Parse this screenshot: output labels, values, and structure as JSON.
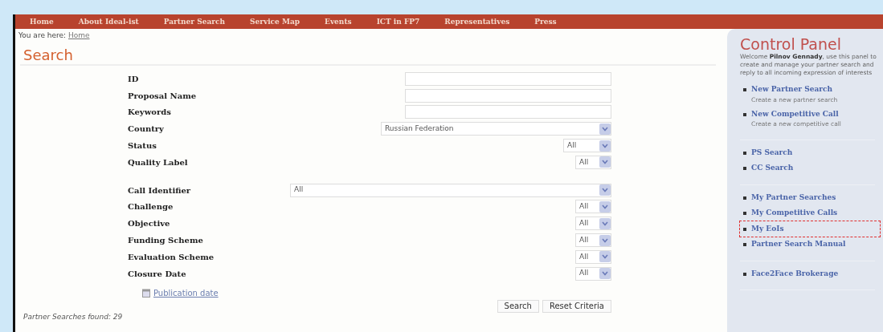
{
  "nav": [
    {
      "label": "Home"
    },
    {
      "label": "About Ideal-ist"
    },
    {
      "label": "Partner Search"
    },
    {
      "label": "Service Map"
    },
    {
      "label": "Events"
    },
    {
      "label": "ICT in FP7"
    },
    {
      "label": "Representatives"
    },
    {
      "label": "Press"
    }
  ],
  "breadcrumb": {
    "prefix": "You are here:",
    "current": "Home"
  },
  "search": {
    "title": "Search",
    "groups": [
      [
        {
          "label": "ID",
          "kind": "text"
        },
        {
          "label": "Proposal Name",
          "kind": "text"
        },
        {
          "label": "Keywords",
          "kind": "text"
        },
        {
          "label": "Country",
          "kind": "select",
          "value": "Russian Federation"
        },
        {
          "label": "Status",
          "kind": "select",
          "value": "All"
        },
        {
          "label": "Quality Label",
          "kind": "select",
          "value": "All"
        }
      ],
      [
        {
          "label": "Call Identifier",
          "kind": "select",
          "value": "All"
        },
        {
          "label": "Challenge",
          "kind": "select",
          "value": "All"
        },
        {
          "label": "Objective",
          "kind": "select",
          "value": "All"
        },
        {
          "label": "Funding Scheme",
          "kind": "select",
          "value": "All"
        },
        {
          "label": "Evaluation Scheme",
          "kind": "select",
          "value": "All"
        },
        {
          "label": "Closure Date",
          "kind": "select",
          "value": "All"
        }
      ]
    ],
    "sort_link": "Publication date",
    "buttons": [
      "Search",
      "Reset Criteria"
    ],
    "results": "Partner Searches found: 29"
  },
  "control_panel": {
    "title": "Control Panel",
    "intro": "Welcome **Pilnov Gennady**, use this panel to create and manage your partner search and reply to all incoming expression of interests",
    "sections": [
      [
        {
          "label": "New Partner Search",
          "description": "Create a new partner search",
          "highlighted": false
        },
        {
          "label": "New Competitive Call",
          "description": "Create a new competitive call",
          "highlighted": false
        }
      ],
      [
        {
          "label": "PS Search",
          "highlighted": false
        },
        {
          "label": "CC Search",
          "highlighted": false
        }
      ],
      [
        {
          "label": "My Partner Searches",
          "highlighted": false
        },
        {
          "label": "My Competitive Calls",
          "highlighted": false
        },
        {
          "label": "My EoIs",
          "highlighted": true
        },
        {
          "label": "Partner Search Manual",
          "highlighted": false
        }
      ],
      [
        {
          "label": "Face2Face Brokerage",
          "highlighted": false
        }
      ]
    ]
  }
}
